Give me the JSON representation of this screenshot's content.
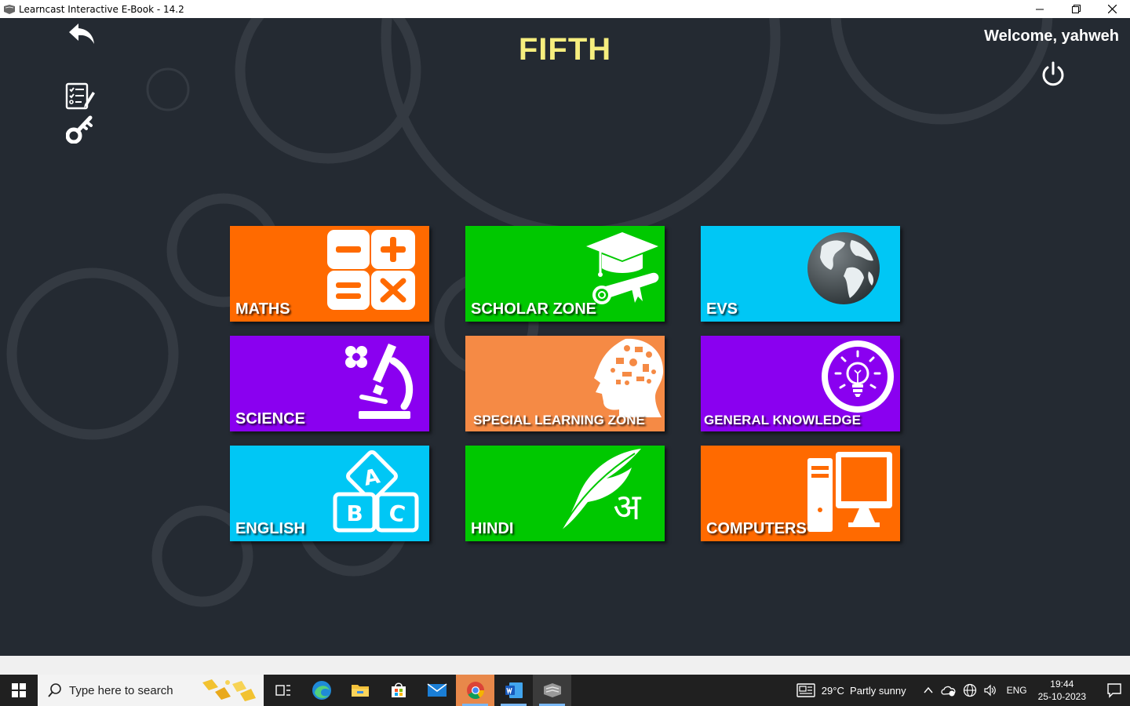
{
  "window": {
    "title": "Learncast Interactive E-Book - 14.2"
  },
  "header": {
    "title": "FIFTH",
    "welcome": "Welcome, yahweh"
  },
  "tiles": [
    {
      "label": "MATHS",
      "color": "#ff6a00",
      "icon": "calculator-icon"
    },
    {
      "label": "SCHOLAR ZONE",
      "color": "#00c800",
      "icon": "graduation-cap-icon"
    },
    {
      "label": "EVS",
      "color": "#00c7f5",
      "icon": "globe-icon"
    },
    {
      "label": "SCIENCE",
      "color": "#8a00f0",
      "icon": "microscope-icon"
    },
    {
      "label": "SPECIAL LEARNING ZONE",
      "color": "#f58a45",
      "icon": "brain-head-icon"
    },
    {
      "label": "GENERAL KNOWLEDGE",
      "color": "#8a00f0",
      "icon": "lightbulb-icon"
    },
    {
      "label": "ENGLISH",
      "color": "#00c7f5",
      "icon": "abc-blocks-icon"
    },
    {
      "label": "HINDI",
      "color": "#00c800",
      "icon": "quill-icon"
    },
    {
      "label": "COMPUTERS",
      "color": "#ff6a00",
      "icon": "computer-icon"
    }
  ],
  "hindi_glyph": "अ",
  "english_letters": [
    "A",
    "B",
    "C"
  ],
  "taskbar": {
    "search_placeholder": "Type here to search",
    "weather": "29°C  Partly sunny",
    "language": "ENG",
    "time": "19:44",
    "date": "25-10-2023"
  }
}
